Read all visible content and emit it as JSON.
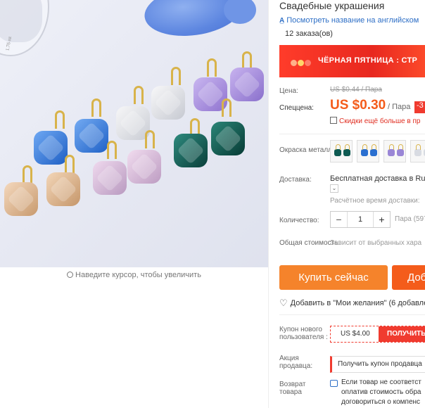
{
  "product_image": {
    "glass_label": "1.76 oz",
    "zoom_hint": "Наведите курсор, чтобы увеличить"
  },
  "product": {
    "title": "Свадебные украшения",
    "translate_link": "Посмотреть название на английском",
    "translate_icon": "translate-icon",
    "orders": "12 заказа(ов)"
  },
  "promo": {
    "banner_text": "ЧЁРНАЯ ПЯТНИЦА : СТР"
  },
  "price": {
    "label_price": "Цена:",
    "old": "US $0.44 / Пара",
    "label_special": "Спеццена:",
    "current": "US $0.30",
    "unit": "/ Пара",
    "discount_badge": "-3",
    "coupon_text": "Скидки ещё больше в пр"
  },
  "color": {
    "label": "Окраска металла:",
    "swatches": [
      "teal",
      "blue",
      "violet",
      "clear"
    ],
    "swatch_colors": [
      "#0e5a52",
      "#2a6fd0",
      "#9a86d6",
      "#d8dbe2"
    ]
  },
  "shipping": {
    "label": "Доставка:",
    "main": "Бесплатная доставка в Ru",
    "dropdown_icon": "chevron-down-icon",
    "estimate": "Расчётное время доставки:"
  },
  "quantity": {
    "label": "Количество:",
    "minus": "−",
    "value": "1",
    "plus": "+",
    "extra": "Пара (597"
  },
  "total": {
    "label": "Общая стоимость:",
    "value": "Зависит от выбранных хара"
  },
  "actions": {
    "buy_now": "Купить сейчас",
    "add_cart": "Доб",
    "wishlist": "Добавить в \"Мои желания\" (6 добавлен"
  },
  "new_user": {
    "label": "Купон нового пользователя :",
    "amount": "US $4.00",
    "get": "ПОЛУЧИТЬ"
  },
  "seller_promo": {
    "label": "Акция продавца:",
    "text": "Получить купон продавца"
  },
  "returns": {
    "label": "Возврат товара",
    "line1": "Если товар не соответст",
    "line2": "оплатив стоимость обра",
    "line3": "договориться о компенс"
  }
}
